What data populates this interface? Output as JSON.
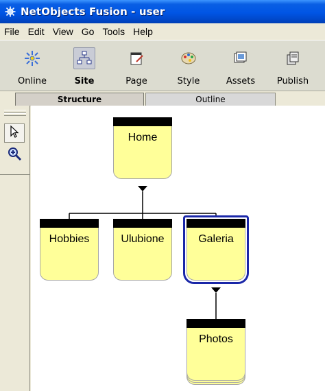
{
  "window": {
    "title": "NetObjects Fusion - user"
  },
  "menu": [
    "File",
    "Edit",
    "View",
    "Go",
    "Tools",
    "Help"
  ],
  "toolbar": {
    "buttons": [
      {
        "label": "Online",
        "icon": "online-icon"
      },
      {
        "label": "Site",
        "icon": "site-icon",
        "active": true
      },
      {
        "label": "Page",
        "icon": "page-icon"
      },
      {
        "label": "Style",
        "icon": "style-icon"
      },
      {
        "label": "Assets",
        "icon": "assets-icon"
      },
      {
        "label": "Publish",
        "icon": "publish-icon"
      }
    ]
  },
  "tabs": {
    "structure": "Structure",
    "outline": "Outline"
  },
  "palette": {
    "tools": [
      "pointer-icon",
      "zoom-icon"
    ]
  },
  "site": {
    "home": "Home",
    "children": [
      "Hobbies",
      "Ulubione",
      "Galeria"
    ],
    "selected": "Galeria",
    "galeria_children": [
      "Photos"
    ]
  },
  "colors": {
    "page_fill": "#ffff99",
    "selection": "#1a27a8",
    "titlebar": "#0055e5"
  }
}
